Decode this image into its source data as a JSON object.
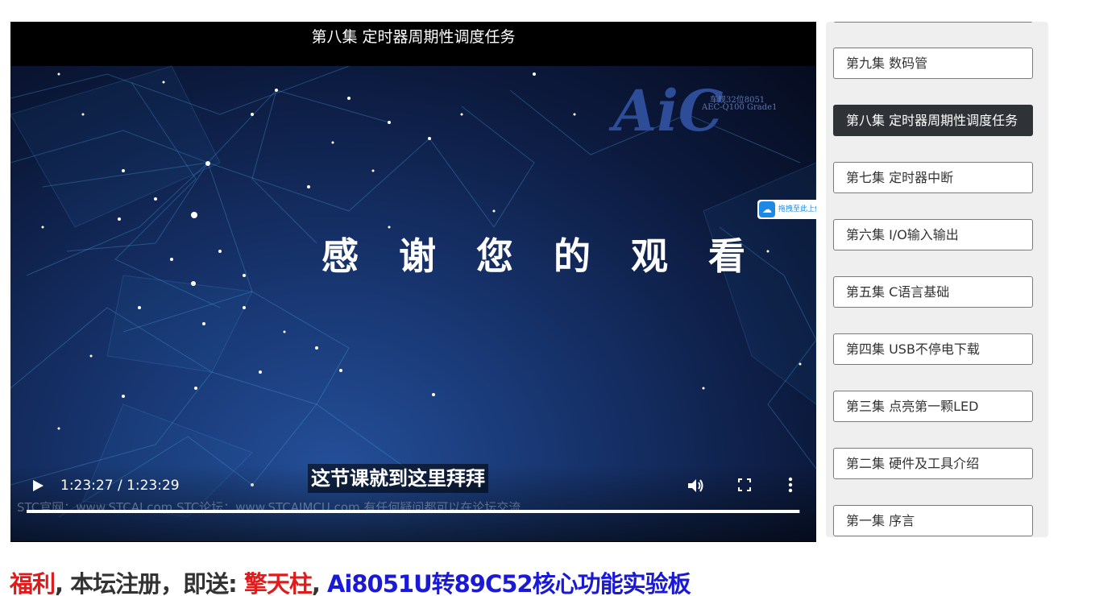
{
  "video": {
    "title": "第八集 定时器周期性调度任务",
    "frame_logo": "AiC",
    "frame_logo_sub1": "车规32位8051",
    "frame_logo_sub2": "AEC-Q100 Grade1",
    "frame_thanks": "感谢您的观看",
    "cloud_badge": "拖拽至此上传",
    "subtitle": "这节课就到这里拜拜",
    "frame_footer": "STC官网：www.STCAI.com      STC论坛：www.STCAIMCU.com      有任何疑问都可以在论坛交流",
    "controls": {
      "time_display": "1:23:27 / 1:23:29",
      "progress_fraction": 0.9989,
      "play_icon": "play-icon",
      "volume_icon": "volume-icon",
      "fullscreen_icon": "fullscreen-icon",
      "more_icon": "more-vertical-icon"
    }
  },
  "playlist": {
    "items": [
      {
        "label": "",
        "active": false
      },
      {
        "label": "第九集 数码管",
        "active": false
      },
      {
        "label": "第八集 定时器周期性调度任务",
        "active": true
      },
      {
        "label": "第七集 定时器中断",
        "active": false
      },
      {
        "label": "第六集 I/O输入输出",
        "active": false
      },
      {
        "label": "第五集 C语言基础",
        "active": false
      },
      {
        "label": "第四集 USB不停电下载",
        "active": false
      },
      {
        "label": "第三集 点亮第一颗LED",
        "active": false
      },
      {
        "label": "第二集 硬件及工具介绍",
        "active": false
      },
      {
        "label": "第一集 序言",
        "active": false
      }
    ]
  },
  "promo": {
    "part1": "福利",
    "part2": ", 本坛注册，即送: ",
    "part3": "擎天柱",
    "part4": ", ",
    "part5": "Ai8051U转89C52核心功能实验板"
  },
  "colors": {
    "active_item_bg": "#2f3237",
    "promo_red": "#e01b1b",
    "promo_blue": "#1a1ad6",
    "promo_gray": "#333333"
  }
}
